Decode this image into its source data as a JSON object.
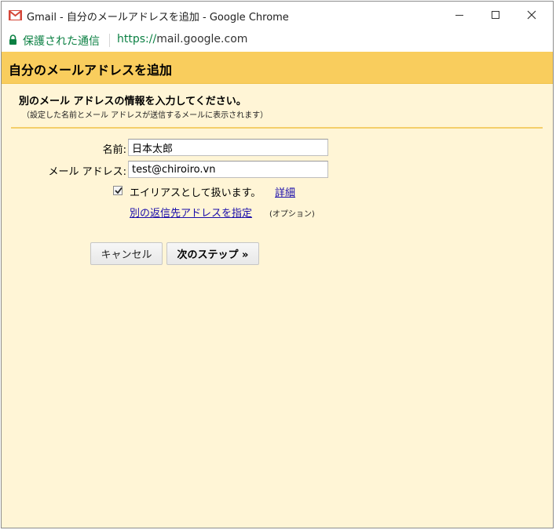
{
  "window": {
    "title": "Gmail - 自分のメールアドレスを追加 - Google Chrome",
    "minimize_icon": "minimize-icon",
    "maximize_icon": "maximize-icon",
    "close_icon": "close-icon"
  },
  "addressbar": {
    "secure_label": "保護された通信",
    "url_scheme": "https://",
    "url_host": "mail.google.com"
  },
  "dialog": {
    "header": "自分のメールアドレスを追加",
    "intro_title": "別のメール アドレスの情報を入力してください。",
    "intro_note": "（設定した名前とメール アドレスが送信するメールに表示されます）",
    "fields": {
      "name_label": "名前:",
      "name_value": "日本太郎",
      "email_label": "メール アドレス:",
      "email_value": "test@chiroiro.vn"
    },
    "alias": {
      "checked": true,
      "label": "エイリアスとして扱います。",
      "details_link": "詳細"
    },
    "reply_to": {
      "link": "別の返信先アドレスを指定",
      "note": "(オプション)"
    },
    "buttons": {
      "cancel": "キャンセル",
      "next": "次のステップ »"
    }
  },
  "colors": {
    "header_bg": "#f9cd5d",
    "content_bg": "#fff5d6",
    "secure_green": "#0b8043",
    "link_blue": "#1a0dab"
  }
}
